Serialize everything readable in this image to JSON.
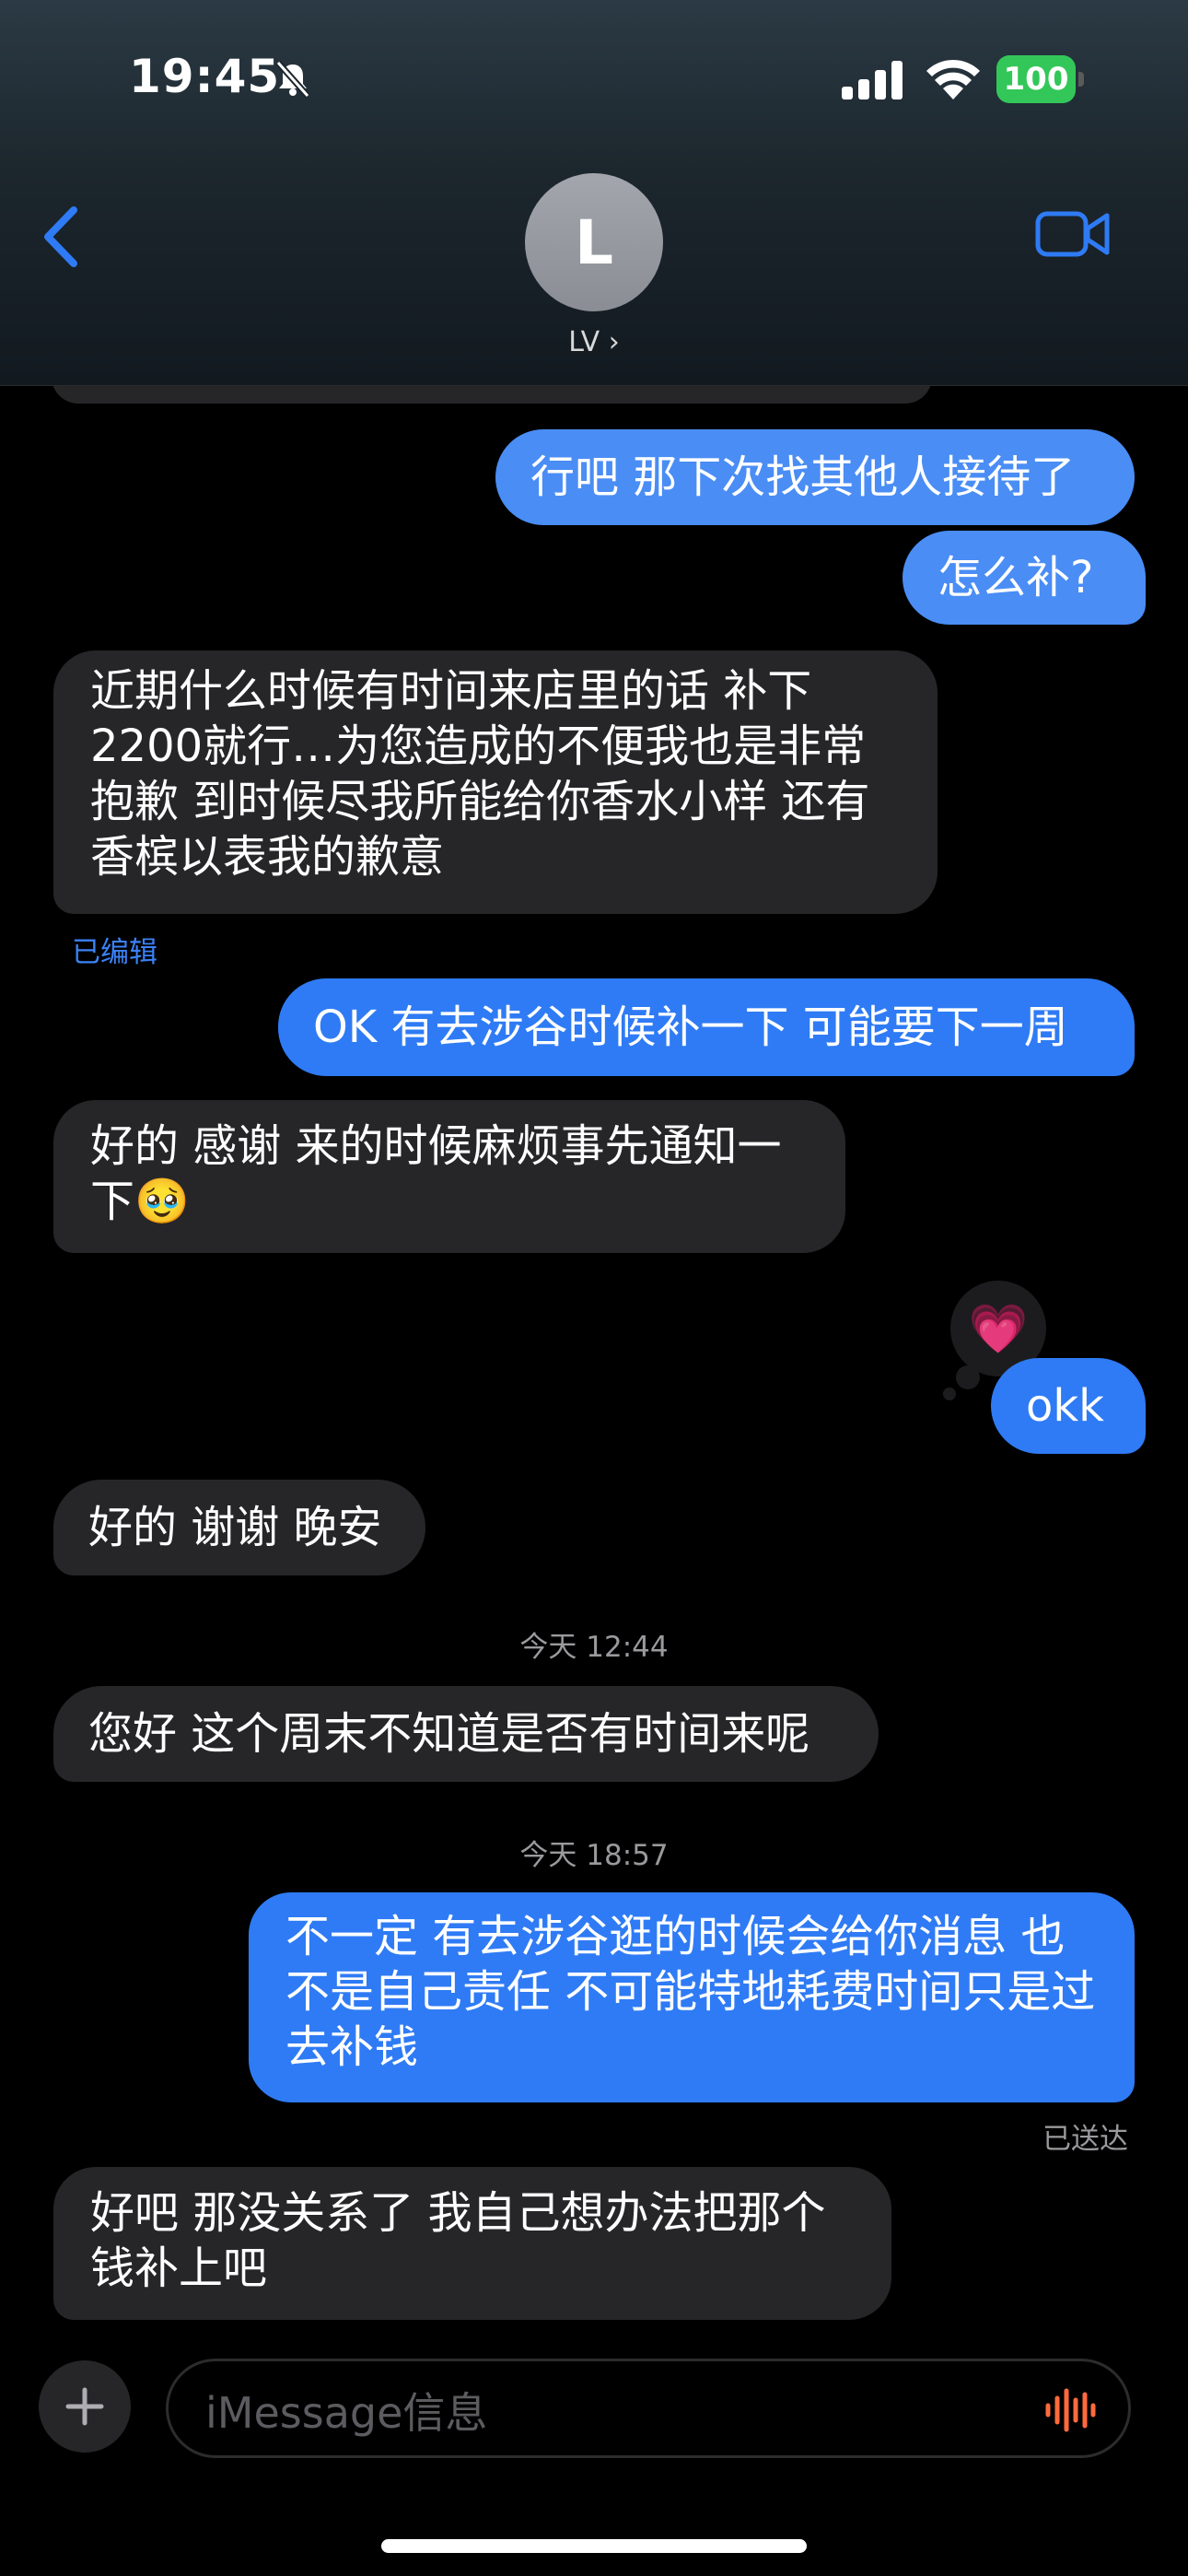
{
  "status_bar": {
    "time": "19:45",
    "battery": "100"
  },
  "contact": {
    "initial": "L",
    "name": "LV ›"
  },
  "messages": [
    {
      "text": "行吧 那下次找其他人接待了"
    },
    {
      "text": "怎么补?"
    },
    {
      "text": "近期什么时候有时间来店里的话 补下 2200就行…为您造成的不便我也是非常抱歉 到时候尽我所能给你香水小样 还有香槟以表我的歉意"
    },
    {
      "text": "OK 有去涉谷时候补一下 可能要下一周"
    },
    {
      "text": "好的 感谢 来的时候麻烦事先通知一下🥹"
    },
    {
      "text": "okk"
    },
    {
      "text": "好的 谢谢 晚安"
    },
    {
      "text": "您好 这个周末不知道是否有时间来呢"
    },
    {
      "text": "不一定 有去涉谷逛的时候会给你消息 也不是自己责任 不可能特地耗费时间只是过去补钱"
    },
    {
      "text": "好吧 那没关系了 我自己想办法把那个钱补上吧"
    }
  ],
  "labels": {
    "edited": "已编辑",
    "time1": "今天 12:44",
    "time2": "今天 18:57",
    "delivered": "已送达",
    "tapback": "💗"
  },
  "compose": {
    "placeholder": "iMessage信息"
  },
  "colors": {
    "outgoing_bubble": "#2f7bf5",
    "incoming_bubble": "#262628",
    "accent": "#2f7bf5"
  }
}
